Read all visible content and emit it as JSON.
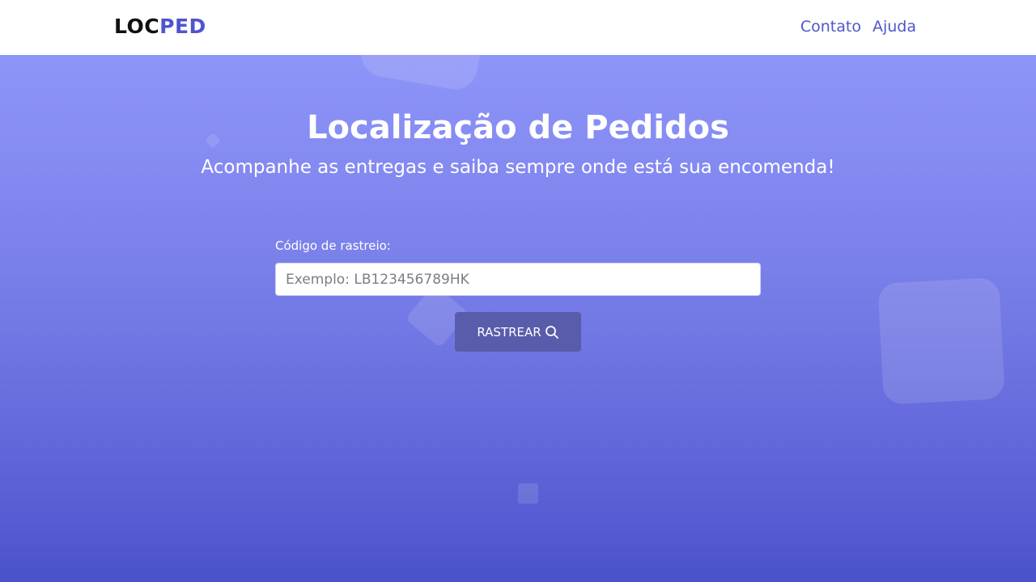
{
  "header": {
    "logo_part1": "LOC",
    "logo_part2": "PED",
    "nav": [
      {
        "label": "Contato"
      },
      {
        "label": "Ajuda"
      }
    ]
  },
  "hero": {
    "title": "Localização de Pedidos",
    "subtitle": "Acompanhe as entregas e saiba sempre onde está sua encomenda!"
  },
  "form": {
    "label": "Código de rastreio:",
    "input_value": "",
    "input_placeholder": "Exemplo: LB123456789HK",
    "button_label": "RASTREAR",
    "button_icon": "search-icon"
  },
  "colors": {
    "brand": "#4f55cc",
    "hero_top": "#8e95f9",
    "hero_bottom": "#4b52c9",
    "button_bg": "#595cab"
  }
}
